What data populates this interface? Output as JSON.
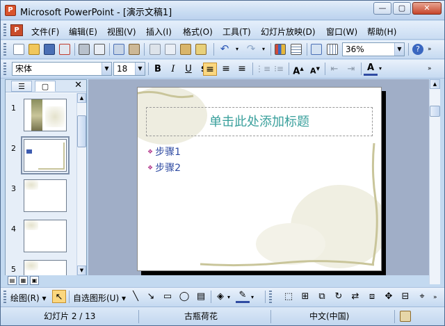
{
  "window": {
    "title": "Microsoft PowerPoint - [演示文稿1]",
    "controls": {
      "minimize": "—",
      "maximize": "▢",
      "close": "✕"
    }
  },
  "menu": {
    "items": [
      "文件(F)",
      "编辑(E)",
      "视图(V)",
      "插入(I)",
      "格式(O)",
      "工具(T)",
      "幻灯片放映(D)",
      "窗口(W)",
      "帮助(H)"
    ]
  },
  "standard_toolbar": {
    "zoom": "36%",
    "icons": [
      "new-icon",
      "open-icon",
      "save-icon",
      "permission-icon",
      "print-icon",
      "print-preview-icon",
      "spelling-icon",
      "research-icon",
      "cut-icon",
      "copy-icon",
      "paste-icon",
      "format-painter-icon",
      "undo-icon",
      "redo-icon",
      "insert-chart-icon",
      "insert-table-icon",
      "insert-picture-icon",
      "show-grid-icon",
      "help-icon"
    ]
  },
  "format_toolbar": {
    "font": "宋体",
    "size": "18",
    "bold": "B",
    "italic": "I",
    "underline": "U"
  },
  "left_pane": {
    "tab_close": "✕",
    "slides": [
      {
        "num": "1"
      },
      {
        "num": "2"
      },
      {
        "num": "3"
      },
      {
        "num": "4"
      },
      {
        "num": "5"
      }
    ]
  },
  "slide": {
    "title_placeholder": "单击此处添加标题",
    "bullets": [
      "步骤1",
      "步骤2"
    ]
  },
  "drawing_toolbar": {
    "draw_label": "绘图(R)",
    "autoshapes_label": "自选图形(U)"
  },
  "status": {
    "slide_info": "幻灯片 2 / 13",
    "design": "古瓶荷花",
    "language": "中文(中国)"
  },
  "colors": {
    "title_text": "#3aa09c",
    "bullet_text": "#2f4ba2",
    "bullet_marker": "#b3398c",
    "workspace_bg": "#a0aec7",
    "chrome_bg": "#c3d9f0"
  }
}
